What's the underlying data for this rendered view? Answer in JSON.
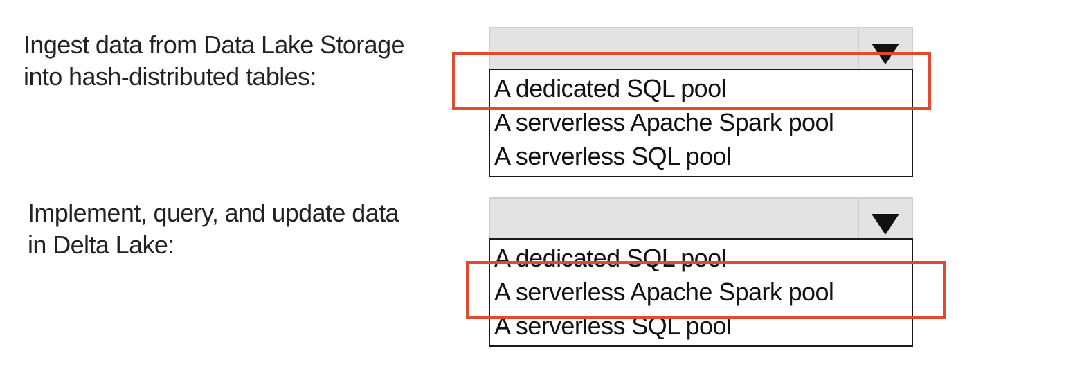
{
  "questions": [
    {
      "prompt_lines": [
        "Ingest data from Data Lake Storage",
        "into hash-distributed tables:"
      ],
      "selected": "",
      "options": [
        "A dedicated SQL pool",
        "A serverless Apache Spark pool",
        "A serverless SQL pool"
      ],
      "highlighted_answer": "A dedicated SQL pool"
    },
    {
      "prompt_lines": [
        "Implement, query, and update data",
        "in Delta Lake:"
      ],
      "selected": "",
      "options": [
        "A dedicated SQL pool",
        "A serverless Apache Spark pool",
        "A serverless SQL pool"
      ],
      "highlighted_answer": "A serverless Apache Spark pool"
    }
  ],
  "colors": {
    "answer_highlight": "#e04a33",
    "select_background": "#e3e3e3"
  },
  "icons": {
    "dropdown": "chevron-down-icon"
  }
}
